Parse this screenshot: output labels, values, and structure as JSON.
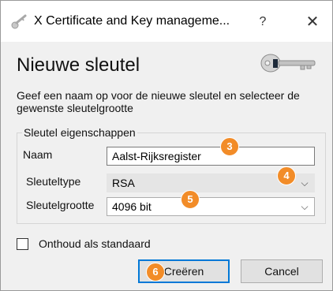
{
  "window": {
    "title": "X Certificate and Key manageme...",
    "help_label": "?",
    "close_label": "✕"
  },
  "dialog": {
    "heading": "Nieuwe sleutel",
    "description": "Geef een naam op voor de nieuwe sleutel en selecteer de gewenste sleutelgrootte"
  },
  "group": {
    "title": "Sleutel eigenschappen",
    "name_label": "Naam",
    "name_value": "Aalst-Rijksregister",
    "type_label": "Sleuteltype",
    "type_value": "RSA",
    "size_label": "Sleutelgrootte",
    "size_value": "4096 bit"
  },
  "checkbox": {
    "label": "Onthoud als standaard",
    "checked": false
  },
  "buttons": {
    "create_label": "Creëren",
    "cancel_label": "Cancel"
  },
  "badges": {
    "b3": "3",
    "b4": "4",
    "b5": "5",
    "b6": "6"
  },
  "colors": {
    "badge": "#f28c28",
    "focus_border": "#0078d7",
    "content_background": "#f0f0f0"
  },
  "icons": {
    "app": "certificate-key-icon",
    "dialog": "key-icon",
    "dropdown": "chevron-down-icon"
  }
}
